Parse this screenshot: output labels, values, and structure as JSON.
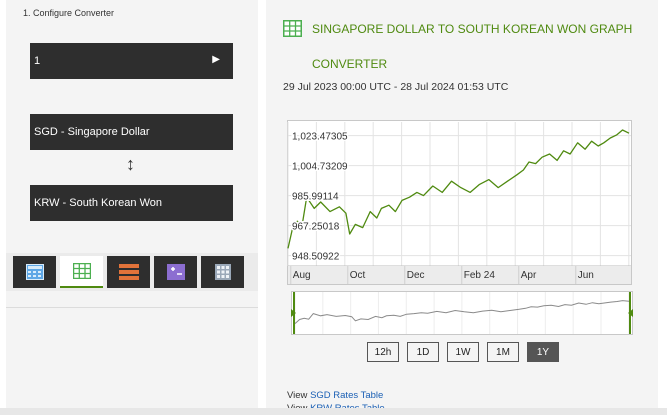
{
  "converter": {
    "step_label": "1. Configure Converter",
    "amount": "1",
    "from_currency": "SGD - Singapore Dollar",
    "to_currency": "KRW - South Korean Won",
    "swap_icon": "swap-vertical-icon",
    "tabs": [
      {
        "icon": "calculator-icon",
        "active": false
      },
      {
        "icon": "grid-chart-icon",
        "active": true
      },
      {
        "icon": "table-rows-icon",
        "active": false
      },
      {
        "icon": "plus-minus-icon",
        "active": false
      },
      {
        "icon": "calendar-grid-icon",
        "active": false
      }
    ]
  },
  "graph": {
    "title_line1": "SINGAPORE DOLLAR TO SOUTH KOREAN WON GRAPH",
    "title_line2": "CONVERTER",
    "date_range": "29 Jul 2023 00:00 UTC - 28 Jul 2024 01:53 UTC",
    "accent_color": "#4f8a10",
    "range_buttons": [
      {
        "label": "12h",
        "active": false
      },
      {
        "label": "1D",
        "active": false
      },
      {
        "label": "1W",
        "active": false
      },
      {
        "label": "1M",
        "active": false
      },
      {
        "label": "1Y",
        "active": true
      }
    ]
  },
  "chart_data": {
    "type": "line",
    "y_tick_labels": [
      "1,023.47305",
      "1,004.73209",
      "985.99114",
      "967.25018",
      "948.50922"
    ],
    "y_ticks": [
      1023.47305,
      1004.73209,
      985.99114,
      967.25018,
      948.50922
    ],
    "x_tick_labels": [
      "Aug",
      "Oct",
      "Dec",
      "Feb 24",
      "Apr",
      "Jun"
    ],
    "x_tick_days": [
      3,
      64,
      125,
      186,
      247,
      308
    ],
    "ylim": [
      942,
      1032
    ],
    "xlim": [
      0,
      365
    ],
    "grid": true,
    "x_days": [
      0,
      5,
      10,
      15,
      20,
      28,
      35,
      45,
      55,
      62,
      66,
      72,
      80,
      88,
      95,
      100,
      108,
      115,
      122,
      130,
      138,
      145,
      155,
      165,
      175,
      185,
      195,
      205,
      215,
      225,
      235,
      245,
      252,
      258,
      265,
      272,
      280,
      288,
      295,
      302,
      310,
      318,
      325,
      332,
      338,
      345,
      352,
      358,
      365
    ],
    "values": [
      953,
      966,
      970,
      967,
      985,
      978,
      982,
      976,
      979,
      975,
      962,
      968,
      966,
      976,
      972,
      978,
      980,
      976,
      983,
      985,
      988,
      986,
      992,
      988,
      995,
      991,
      988,
      993,
      996,
      991,
      995,
      999,
      1002,
      1007,
      1006,
      1010,
      1012,
      1008,
      1014,
      1012,
      1019,
      1015,
      1020,
      1017,
      1019,
      1022,
      1024,
      1027,
      1025
    ]
  },
  "links": {
    "view_label": "View",
    "sgd_rates": "SGD Rates Table",
    "krw_rates": "KRW Rates Table"
  }
}
